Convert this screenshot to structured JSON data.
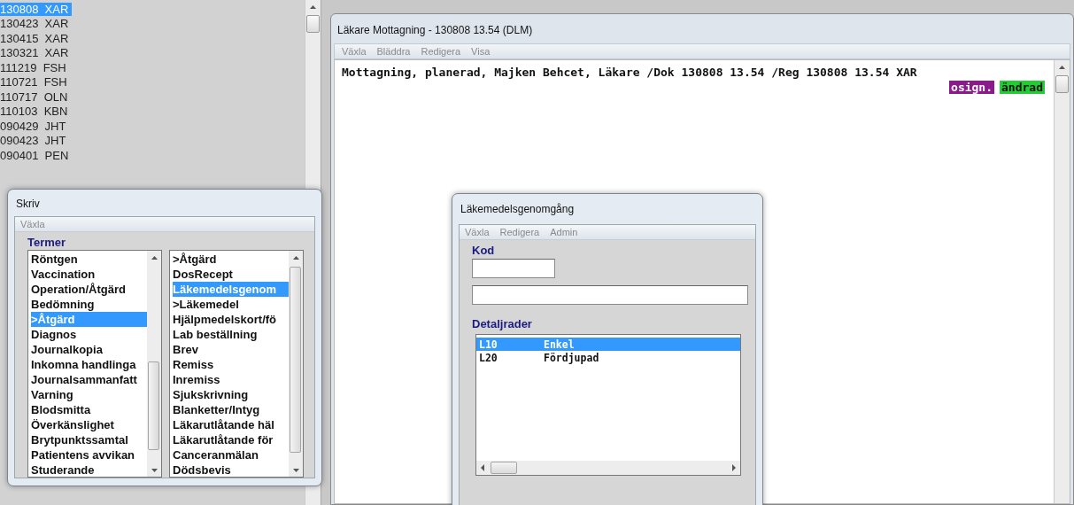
{
  "record_list": {
    "items": [
      {
        "date": "130808",
        "sign": "XAR",
        "selected": true
      },
      {
        "date": "130423",
        "sign": "XAR",
        "selected": false
      },
      {
        "date": "130415",
        "sign": "XAR",
        "selected": false
      },
      {
        "date": "130321",
        "sign": "XAR",
        "selected": false
      },
      {
        "date": "111219",
        "sign": "FSH",
        "selected": false
      },
      {
        "date": "110721",
        "sign": "FSH",
        "selected": false
      },
      {
        "date": "110717",
        "sign": "OLN",
        "selected": false
      },
      {
        "date": "110103",
        "sign": "KBN",
        "selected": false
      },
      {
        "date": "090429",
        "sign": "JHT",
        "selected": false
      },
      {
        "date": "090423",
        "sign": "JHT",
        "selected": false
      },
      {
        "date": "090401",
        "sign": "PEN",
        "selected": false
      }
    ]
  },
  "main_window": {
    "title": "Läkare Mottagning - 130808 13.54  (DLM)",
    "menu": [
      "Växla",
      "Bläddra",
      "Redigera",
      "Visa"
    ],
    "text": "Mottagning, planerad, Majken Behcet, Läkare /Dok 130808 13.54 /Reg 130808 13.54 XAR",
    "badges": [
      {
        "label": "osign.",
        "color": "#8b1a8b"
      },
      {
        "label": "ändrad",
        "color": "#22cc33"
      }
    ]
  },
  "skriv_dialog": {
    "title": "Skriv",
    "menu": [
      "Växla"
    ],
    "section_label": "Termer",
    "left_list": [
      {
        "label": "Röntgen",
        "selected": false
      },
      {
        "label": "Vaccination",
        "selected": false
      },
      {
        "label": "Operation/Åtgärd",
        "selected": false
      },
      {
        "label": "Bedömning",
        "selected": false
      },
      {
        "label": ">Åtgärd",
        "selected": true
      },
      {
        "label": "Diagnos",
        "selected": false
      },
      {
        "label": "Journalkopia",
        "selected": false
      },
      {
        "label": "Inkomna handlinga",
        "selected": false
      },
      {
        "label": "Journalsammanfatt",
        "selected": false
      },
      {
        "label": "Varning",
        "selected": false
      },
      {
        "label": "Blodsmitta",
        "selected": false
      },
      {
        "label": "Överkänslighet",
        "selected": false
      },
      {
        "label": "Brytpunktssamtal",
        "selected": false
      },
      {
        "label": "Patientens avvikan",
        "selected": false
      },
      {
        "label": "Studerande",
        "selected": false
      }
    ],
    "right_list": [
      {
        "label": ">Åtgärd",
        "selected": false
      },
      {
        "label": "DosRecept",
        "selected": false
      },
      {
        "label": "Läkemedelsgenom",
        "selected": true
      },
      {
        "label": ">Läkemedel",
        "selected": false
      },
      {
        "label": "Hjälpmedelskort/fö",
        "selected": false
      },
      {
        "label": "Lab beställning",
        "selected": false
      },
      {
        "label": "Brev",
        "selected": false
      },
      {
        "label": "Remiss",
        "selected": false
      },
      {
        "label": "Inremiss",
        "selected": false
      },
      {
        "label": "Sjukskrivning",
        "selected": false
      },
      {
        "label": "Blanketter/Intyg",
        "selected": false
      },
      {
        "label": "Läkarutlåtande häl",
        "selected": false
      },
      {
        "label": "Läkarutlåtande för",
        "selected": false
      },
      {
        "label": "Canceranmälan",
        "selected": false
      },
      {
        "label": "Dödsbevis",
        "selected": false
      }
    ]
  },
  "medication_dialog": {
    "title": "Läkemedelsgenomgång",
    "menu": [
      "Växla",
      "Redigera",
      "Admin"
    ],
    "code_label": "Kod",
    "detail_label": "Detaljrader",
    "rows": [
      {
        "code": "L10",
        "name": "Enkel",
        "selected": true
      },
      {
        "code": "L20",
        "name": "Fördjupad",
        "selected": false
      }
    ]
  }
}
